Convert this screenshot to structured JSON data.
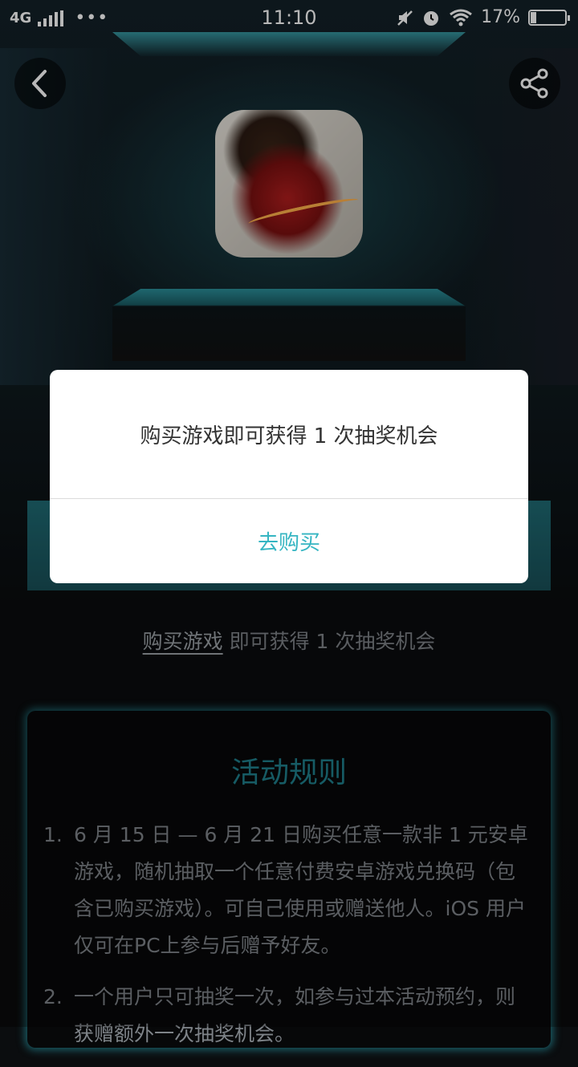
{
  "status_bar": {
    "network": "4G",
    "dots": "•••",
    "time": "11:10",
    "battery_percent_text": "17%",
    "battery_level": 0.17
  },
  "header": {
    "back_icon": "chevron-left-icon",
    "share_icon": "share-icon"
  },
  "game": {
    "icon": "game-app-icon"
  },
  "dialog": {
    "message": "购买游戏即可获得 1 次抽奖机会",
    "button_label": "去购买"
  },
  "tip": {
    "link_text": "购买游戏",
    "rest_text": " 即可获得 1 次抽奖机会"
  },
  "rules": {
    "title": "活动规则",
    "items": [
      {
        "num": "1.",
        "text": "6 月 15 日 — 6 月 21 日购买任意一款非 1 元安卓游戏，随机抽取一个任意付费安卓游戏兑换码（包含已购买游戏）。可自己使用或赠送他人。iOS 用户仅可在PC上参与后赠予好友。"
      },
      {
        "num": "2.",
        "text": "一个用户只可抽奖一次，如参与过本活动预约，则获赠额外一次抽奖机会。"
      }
    ]
  },
  "colors": {
    "accent": "#35b5c2",
    "rules_title": "#1f7f8b",
    "teal_box": "#1f6a73"
  }
}
